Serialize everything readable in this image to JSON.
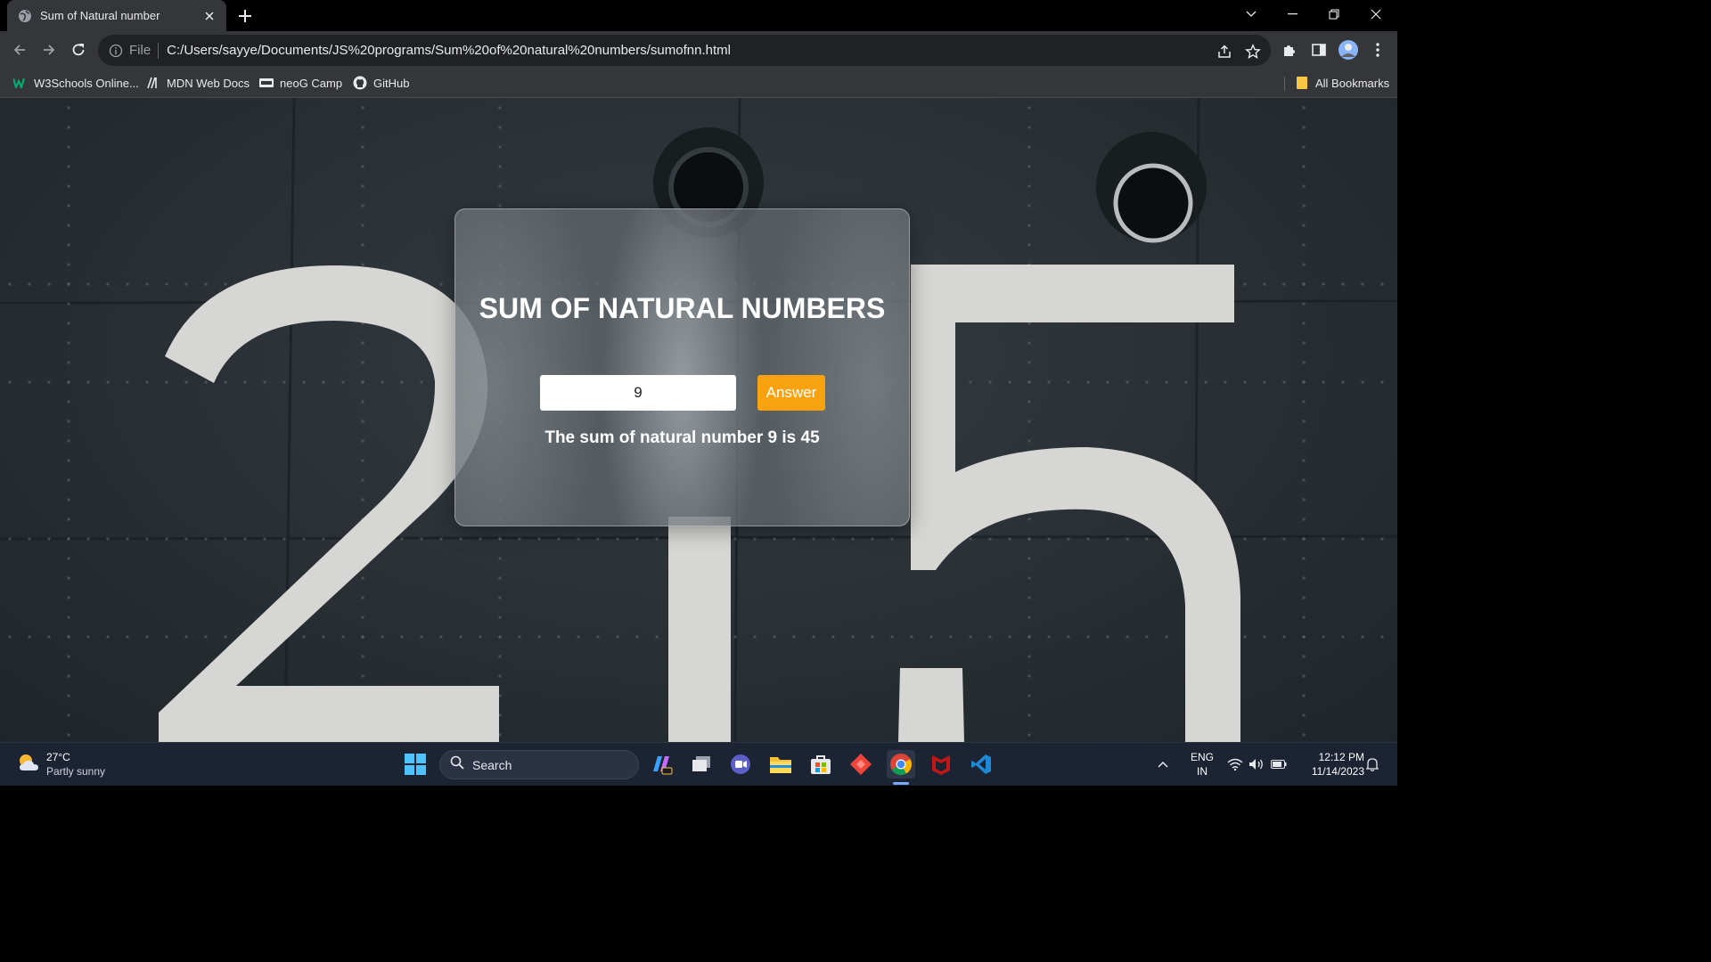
{
  "browser": {
    "tab": {
      "title": "Sum of Natural number",
      "favicon": "globe-icon"
    },
    "address": {
      "prefix": "File",
      "url": "C:/Users/sayye/Documents/JS%20programs/Sum%20of%20natural%20numbers/sumofnn.html"
    },
    "bookmarks": [
      {
        "label": "W3Schools Online...",
        "icon": "w3schools-icon"
      },
      {
        "label": "MDN Web Docs",
        "icon": "mdn-icon"
      },
      {
        "label": "neoG Camp",
        "icon": "neog-icon"
      },
      {
        "label": "GitHub",
        "icon": "github-icon"
      }
    ],
    "all_bookmarks_label": "All Bookmarks"
  },
  "page": {
    "title": "SUM OF NATURAL NUMBERS",
    "input_value": "9",
    "button_label": "Answer",
    "result": "The sum of natural number 9 is 45",
    "background_numbers": [
      "2",
      "1",
      "5"
    ],
    "accent_color": "#f9a20f"
  },
  "taskbar": {
    "weather": {
      "temp": "27°C",
      "condition": "Partly sunny"
    },
    "search_label": "Search",
    "language": {
      "line1": "ENG",
      "line2": "IN"
    },
    "time": "12:12 PM",
    "date": "11/14/2023"
  }
}
